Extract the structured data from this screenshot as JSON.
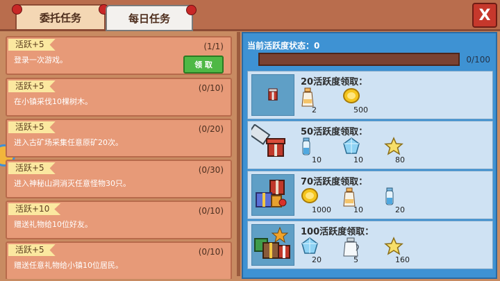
{
  "tabs": [
    {
      "label": "委托任务",
      "active": false
    },
    {
      "label": "每日任务",
      "active": true
    }
  ],
  "close_label": "X",
  "tasks": [
    {
      "badge": "活跃+5",
      "desc": "登录一次游戏。",
      "progress": "(1/1)",
      "claim_label": "领 取"
    },
    {
      "badge": "活跃+5",
      "desc": "在小镇采伐10棵树木。",
      "progress": "(0/10)"
    },
    {
      "badge": "活跃+5",
      "desc": "进入古矿场采集任意原矿20次。",
      "progress": "(0/20)"
    },
    {
      "badge": "活跃+5",
      "desc": "进入神秘山洞消灭任意怪物30只。",
      "progress": "(0/30)"
    },
    {
      "badge": "活跃+10",
      "desc": "赠送礼物给10位好友。",
      "progress": "(0/10)"
    },
    {
      "badge": "活跃+5",
      "desc": "赠送任意礼物给小镇10位居民。",
      "progress": "(0/10)"
    }
  ],
  "activity": {
    "status_label": "当前活跃度状态：0",
    "progress_text": "0/100",
    "progress_fraction": 0
  },
  "rewards": [
    {
      "title": "20活跃度领取：",
      "icon": "small-gift-icon",
      "items": [
        {
          "icon": "milk-bottle-icon",
          "value": "2"
        },
        {
          "icon": "gold-coin-icon",
          "value": "500"
        }
      ]
    },
    {
      "title": "50活跃度领取：",
      "icon": "gift-box-icon",
      "items": [
        {
          "icon": "potion-vial-icon",
          "value": "10"
        },
        {
          "icon": "crystal-icon",
          "value": "10"
        },
        {
          "icon": "star-icon",
          "value": "80"
        }
      ]
    },
    {
      "title": "70活跃度领取：",
      "icon": "gift-pile-icon",
      "items": [
        {
          "icon": "gold-coin-icon",
          "value": "1000"
        },
        {
          "icon": "milk-bottle-icon",
          "value": "10"
        },
        {
          "icon": "potion-vial-icon",
          "value": "20"
        }
      ]
    },
    {
      "title": "100活跃度领取：",
      "icon": "big-gift-pile-icon",
      "items": [
        {
          "icon": "crystal-icon",
          "value": "20"
        },
        {
          "icon": "milk-jug-icon",
          "value": "5"
        },
        {
          "icon": "star-icon",
          "value": "160"
        }
      ]
    }
  ],
  "colors": {
    "panel": "#c88b62",
    "task_card": "#e79a78",
    "claim_button": "#4fb845",
    "reward_panel": "#3e92d3",
    "reward_row": "#cfe2f3"
  }
}
